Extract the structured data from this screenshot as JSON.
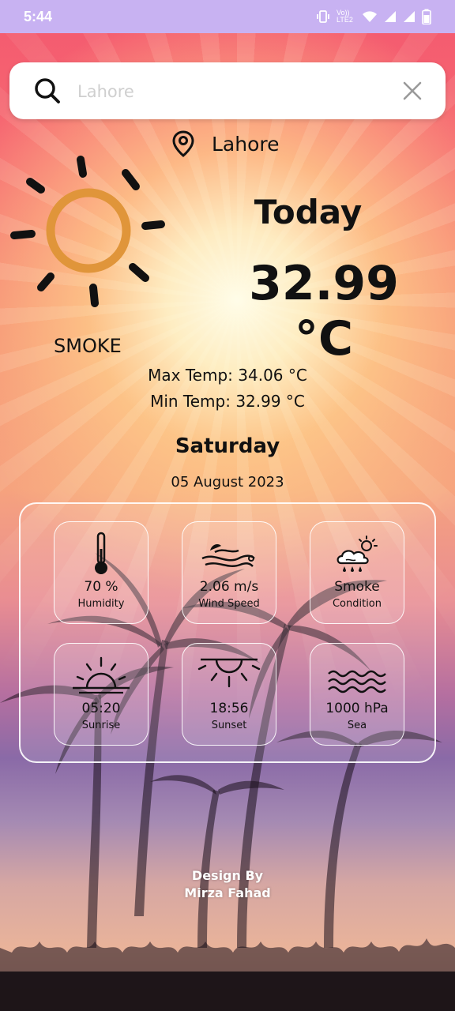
{
  "status_bar": {
    "time": "5:44",
    "network_label": "Vo)) LTE2"
  },
  "search": {
    "placeholder": "Lahore",
    "value": ""
  },
  "location": {
    "city": "Lahore"
  },
  "weather": {
    "heading": "Today",
    "temperature": "32.99 °C",
    "condition": "SMOKE",
    "max_temp": "Max Temp: 34.06 °C",
    "min_temp": "Min Temp: 32.99 °C",
    "day": "Saturday",
    "date": "05 August 2023"
  },
  "details": [
    {
      "icon": "thermometer-icon",
      "value": "70 %",
      "label": "Humidity"
    },
    {
      "icon": "wind-icon",
      "value": "2.06 m/s",
      "label": "Wind Speed"
    },
    {
      "icon": "cloud-sun-rain-icon",
      "value": "Smoke",
      "label": "Condition"
    },
    {
      "icon": "sunrise-icon",
      "value": "05:20",
      "label": "Sunrise"
    },
    {
      "icon": "sunset-icon",
      "value": "18:56",
      "label": "Sunset"
    },
    {
      "icon": "waves-icon",
      "value": "1000 hPa",
      "label": "Sea"
    }
  ],
  "footer": {
    "line1": "Design By",
    "line2": "Mirza Fahad"
  },
  "colors": {
    "status_bar": "#c8b2f2",
    "sun_ring": "#e0953a",
    "text": "#111111"
  }
}
